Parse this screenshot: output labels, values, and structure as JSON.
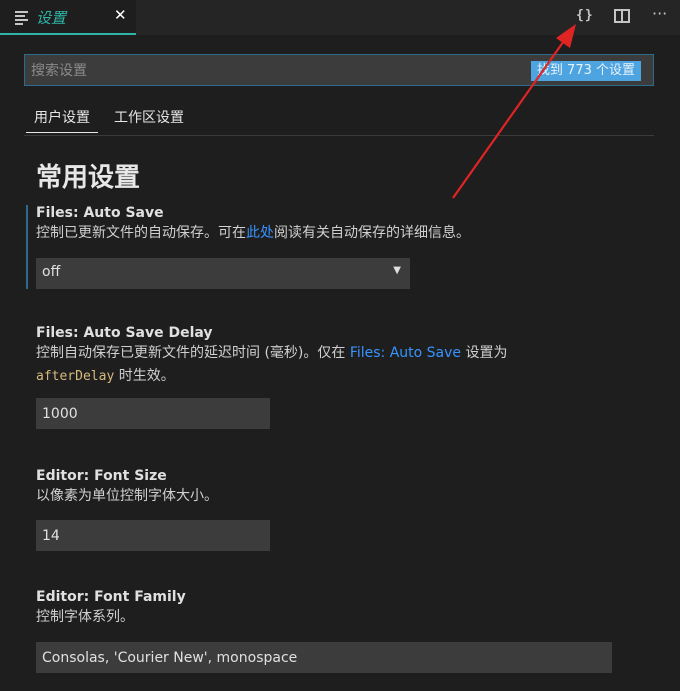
{
  "tab": {
    "title": "设置",
    "close_glyph": "✕",
    "icon": "document-lines-icon"
  },
  "toolbar": {
    "open_json_glyph": "{}",
    "open_json_icon": "braces-icon",
    "split_icon": "split-editor-icon",
    "more_glyph": "···",
    "more_icon": "more-actions-icon"
  },
  "search": {
    "placeholder": "搜索设置",
    "value": "",
    "result_count": "找到 773 个设置"
  },
  "scope_tabs": [
    {
      "label": "用户设置",
      "active": true
    },
    {
      "label": "工作区设置",
      "active": false
    }
  ],
  "section": {
    "title": "常用设置"
  },
  "settings": {
    "auto_save": {
      "label": "Files: Auto Save",
      "desc_before": "控制已更新文件的自动保存。可在",
      "desc_link": "此处",
      "desc_after": "阅读有关自动保存的详细信息。",
      "value": "off"
    },
    "auto_save_delay": {
      "label": "Files: Auto Save Delay",
      "desc_before": "控制自动保存已更新文件的延迟时间 (毫秒)。仅在 ",
      "desc_link": "Files: Auto Save",
      "desc_after": " 设置为",
      "desc_code": "afterDelay",
      "desc_tail": " 时生效。",
      "value": "1000"
    },
    "font_size": {
      "label": "Editor: Font Size",
      "desc": "以像素为单位控制字体大小。",
      "value": "14"
    },
    "font_family": {
      "label": "Editor: Font Family",
      "desc": "控制字体系列。",
      "value": "Consolas, 'Courier New', monospace"
    }
  },
  "colors": {
    "accent": "#2fb5a8",
    "link": "#3794ff",
    "annotation_arrow": "#e02424",
    "badge": "#4da4e0"
  }
}
